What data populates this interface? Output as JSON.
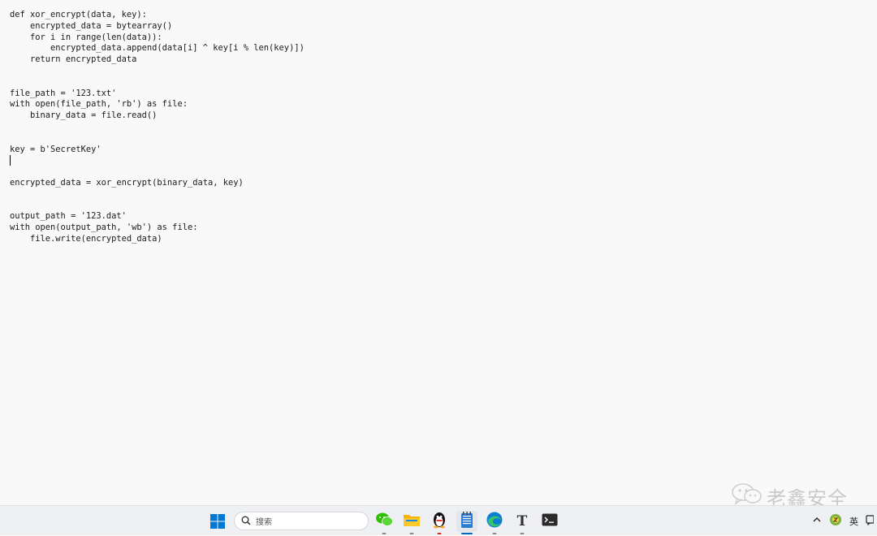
{
  "editor": {
    "lines": [
      "def xor_encrypt(data, key):",
      "    encrypted_data = bytearray()",
      "    for i in range(len(data)):",
      "        encrypted_data.append(data[i] ^ key[i % len(key)])",
      "    return encrypted_data",
      "",
      "",
      "file_path = '123.txt'",
      "with open(file_path, 'rb') as file:",
      "    binary_data = file.read()",
      "",
      "",
      "key = b'SecretKey'",
      "",
      "",
      "encrypted_data = xor_encrypt(binary_data, key)",
      "",
      "",
      "output_path = '123.dat'",
      "with open(output_path, 'wb') as file:",
      "    file.write(encrypted_data)"
    ],
    "caret_line": 13
  },
  "watermark": {
    "text": "老鑫安全",
    "icon": "wechat-icon"
  },
  "taskbar": {
    "start_icon": "windows-start-icon",
    "search_placeholder": "搜索",
    "search_icon": "search-icon",
    "apps": [
      {
        "name": "wechat",
        "icon": "wechat-icon",
        "color": "#2dc100"
      },
      {
        "name": "file-explorer",
        "icon": "folder-icon",
        "color": "#f4b400"
      },
      {
        "name": "qq",
        "icon": "qq-penguin-icon",
        "color": "#000000"
      },
      {
        "name": "notepad",
        "icon": "notepad-icon",
        "color": "#2b7cd3",
        "active": true
      },
      {
        "name": "edge",
        "icon": "edge-icon",
        "color": "#0c7fd3"
      },
      {
        "name": "typora",
        "icon": "typora-icon",
        "color": "#333333",
        "label": "T"
      },
      {
        "name": "terminal",
        "icon": "terminal-icon",
        "color": "#2b2b2b"
      }
    ],
    "tray": {
      "chevron_icon": "chevron-up-icon",
      "ime_icon": "ime-status-icon",
      "language": "英",
      "notification_icon": "notification-icon"
    }
  },
  "colors": {
    "background": "#f9f9f9",
    "accent": "#0067c0"
  }
}
